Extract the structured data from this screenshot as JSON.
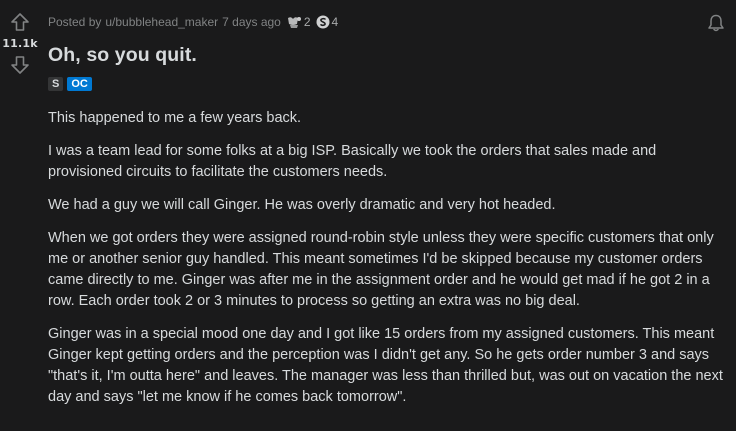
{
  "post": {
    "score": "11.1k",
    "posted_by": "Posted by",
    "username": "u/bubblehead_maker",
    "time_ago": "7 days ago",
    "awards": [
      {
        "icon": "trophy-award-icon",
        "count": "2"
      },
      {
        "icon": "silver-award-icon",
        "count": "4"
      }
    ],
    "title": "Oh, so you quit.",
    "flairs": [
      "S",
      "OC"
    ],
    "paragraphs": [
      "This happened to me a few years back.",
      "I was a team lead for some folks at a big ISP. Basically we took the orders that sales made and provisioned circuits to facilitate the customers needs.",
      "We had a guy we will call Ginger. He was overly dramatic and very hot headed.",
      "When we got orders they were assigned round-robin style unless they were specific customers that only me or another senior guy handled. This meant sometimes I'd be skipped because my customer orders came directly to me. Ginger was after me in the assignment order and he would get mad if he got 2 in a row. Each order took 2 or 3 minutes to process so getting an extra was no big deal.",
      "Ginger was in a special mood one day and I got like 15 orders from my assigned customers. This meant Ginger kept getting orders and the perception was I didn't get any. So he gets order number 3 and says \"that's it, I'm outta here\" and leaves. The manager was less than thrilled but, was out on vacation the next day and says \"let me know if he comes back tomorrow\"."
    ]
  },
  "colors": {
    "background": "#1a1a1b",
    "text": "#d7dadc",
    "meta": "#818384",
    "oc_flair": "#0079d3"
  }
}
